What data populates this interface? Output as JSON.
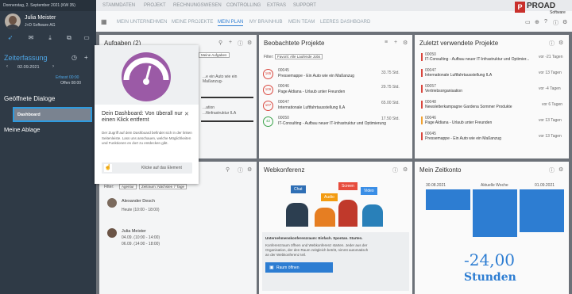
{
  "header": {
    "date": "Donnerstag, 2. September 2021 (KW 35)"
  },
  "user": {
    "name": "Julia Meister",
    "company": "J+D Software AG"
  },
  "zeit": {
    "title": "Zeiterfassung",
    "date": "02.09.2021",
    "erfasst": "Erfasst 00:00",
    "offen": "Offen 08:00"
  },
  "sidebar": {
    "sec_open": "Geöffnete Dialoge",
    "dash": "Dashboard",
    "sec_ablage": "Meine Ablage"
  },
  "nav": [
    "STAMMDATEN",
    "PROJEKT",
    "RECHNUNGSWESEN",
    "CONTROLLING",
    "EXTRAS",
    "SUPPORT"
  ],
  "subnav": [
    "MEIN UNTERNEHMEN",
    "MEINE PROJEKTE",
    "MEIN PLAN",
    "MY BRAINHUB",
    "MEIN TEAM",
    "LEERES DASHBOARD"
  ],
  "logo": {
    "name": "PROAD",
    "sub": "Software"
  },
  "aufgaben": {
    "title": "Aufgaben (2)",
    "tag": "Meine Aufgaben",
    "r1": "...e ein Auto wie ein Maßanzug-",
    "r2": "...ation",
    "r3": "...ftinfrastruktur ILA"
  },
  "beo": {
    "title": "Beobachtete Projekte",
    "filter": "Filter:",
    "filter_val": "Favorit: Alle Laufende Jobs",
    "items": [
      {
        "num": "00045",
        "name": "Pressemappe - Ein Auto wie ein Maßanzug",
        "val": "33.75 Std.",
        "badge": "165"
      },
      {
        "num": "00046",
        "name": "Page Aldiana - Urlaub unter Freunden",
        "val": "29.75 Std.",
        "badge": "106"
      },
      {
        "num": "00047",
        "name": "Internationale Luftfahrtausstellung ILA",
        "val": "65.00 Std.",
        "badge": "107"
      },
      {
        "num": "00050",
        "name": "IT-Consulting - Aufbau neuer IT-Infrastruktur und Optimierung",
        "val": "17.50 Std.",
        "badge": "42"
      }
    ]
  },
  "zuletzt": {
    "title": "Zuletzt verwendete Projekte",
    "items": [
      {
        "num": "00050",
        "name": "IT-Consulting - Aufbau neuer IT-Infrastruktur und Optimier...",
        "val": "vor -21 Tagen"
      },
      {
        "num": "00047",
        "name": "Internationale Luftfahrtausstellung ILA",
        "val": "vor 13 Tagen"
      },
      {
        "num": "00057",
        "name": "Vertriebsorganisation",
        "val": "vor -4 Tagen"
      },
      {
        "num": "00048",
        "name": "Newsletterkampagne Gardena Sommer Produkte",
        "val": "vor 6 Tagen"
      },
      {
        "num": "00046",
        "name": "Page Aldiana - Urlaub unter Freunden",
        "val": "vor 13 Tagen"
      },
      {
        "num": "00045",
        "name": "Pressemappe - Ein Auto wie ein Maßanzug",
        "val": "vor 13 Tagen"
      }
    ]
  },
  "team": {
    "filter": "Filter:",
    "tag1": "Agentur",
    "tag2": "Zeitraum: Nächsten 7 Tage",
    "p1": {
      "name": "Alexander Desch",
      "time": "Heute (10:00 - 18:00)"
    },
    "p2": {
      "name": "Julia Meister",
      "t1": "04.09. (10:00 - 14:00)",
      "t2": "06.09. (14:00 - 18:00)"
    }
  },
  "web": {
    "title": "Webkonferenz",
    "bubbles": [
      "Chat",
      "Screen",
      "Audio",
      "Video"
    ],
    "h": "Unternehmenskonferenzraum: Einfach. Spontan. Starten.",
    "p": "Konferenzraum öffnen und Webkonferenz starten. Jeder aus der Organisation, der den Raum zeitgleich betritt, nimmt automatisch an der Webkonferenz teil.",
    "btn": "Raum öffnen"
  },
  "zeitkonto": {
    "title": "Mein Zeitkonto",
    "d1": "30.08.2021",
    "wk": "Aktuelle Woche",
    "d2": "01.09.2021",
    "value": "-24,00",
    "unit": "Stunden"
  },
  "modal": {
    "title": "Dein Dashboard: Von überall nur einen Klick entfernt",
    "text": "Der Zugriff auf dein Dashboard befindet sich in der linken Seitenleiste. Lass uns anschauen, welche Möglichkeiten und Funktionen es dort zu entdecken gibt.",
    "btn": "Klicke auf das Element"
  }
}
